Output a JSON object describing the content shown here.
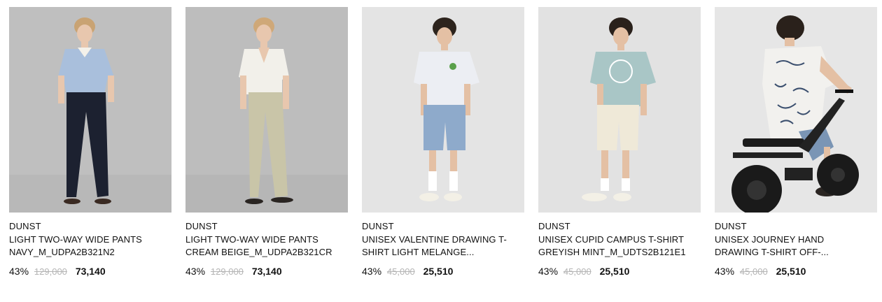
{
  "products": [
    {
      "brand": "DUNST",
      "name_line1": "LIGHT TWO-WAY WIDE PANTS",
      "name_line2": "NAVY_M_UDPA2B321N2",
      "discount": "43%",
      "original_price": "129,000",
      "sale_price": "73,140",
      "image": {
        "bg": "#bfbfbf",
        "top": "#a9bfdc",
        "bottom": "#1c2130",
        "hair": "#c9a373",
        "skin": "#e8c7ae",
        "shoe": "#3a2a22"
      }
    },
    {
      "brand": "DUNST",
      "name_line1": "LIGHT TWO-WAY WIDE PANTS",
      "name_line2": "CREAM BEIGE_M_UDPA2B321CR",
      "discount": "43%",
      "original_price": "129,000",
      "sale_price": "73,140",
      "image": {
        "bg": "#bdbdbd",
        "top": "#f2f0ea",
        "bottom": "#c9c5a8",
        "hair": "#cfa878",
        "skin": "#e8c7ae",
        "shoe": "#2a2522"
      }
    },
    {
      "brand": "DUNST",
      "name_line1": "UNISEX VALENTINE DRAWING T-",
      "name_line2": "SHIRT LIGHT MELANGE...",
      "discount": "43%",
      "original_price": "45,000",
      "sale_price": "25,510",
      "image": {
        "bg": "#e4e4e4",
        "top": "#eceef3",
        "bottom": "#8eaacb",
        "hair": "#2d241d",
        "skin": "#e4c0a4",
        "shoe": "#f3f0e6"
      }
    },
    {
      "brand": "DUNST",
      "name_line1": "UNISEX CUPID CAMPUS T-SHIRT",
      "name_line2": "GREYISH MINT_M_UDTS2B121E1",
      "discount": "43%",
      "original_price": "45,000",
      "sale_price": "25,510",
      "image": {
        "bg": "#e2e2e2",
        "top": "#a9c6c6",
        "bottom": "#efe9d8",
        "hair": "#2a211b",
        "skin": "#e4c0a4",
        "shoe": "#f3f0e6"
      }
    },
    {
      "brand": "DUNST",
      "name_line1": "UNISEX JOURNEY HAND",
      "name_line2": "DRAWING T-SHIRT OFF-...",
      "discount": "43%",
      "original_price": "45,000",
      "sale_price": "25,510",
      "image": {
        "bg": "#e6e6e6",
        "top": "#f2f1ee",
        "bottom": "#7a95b5",
        "hair": "#2a211b",
        "skin": "#e4c0a4",
        "shoe": "#2a2522"
      }
    }
  ]
}
